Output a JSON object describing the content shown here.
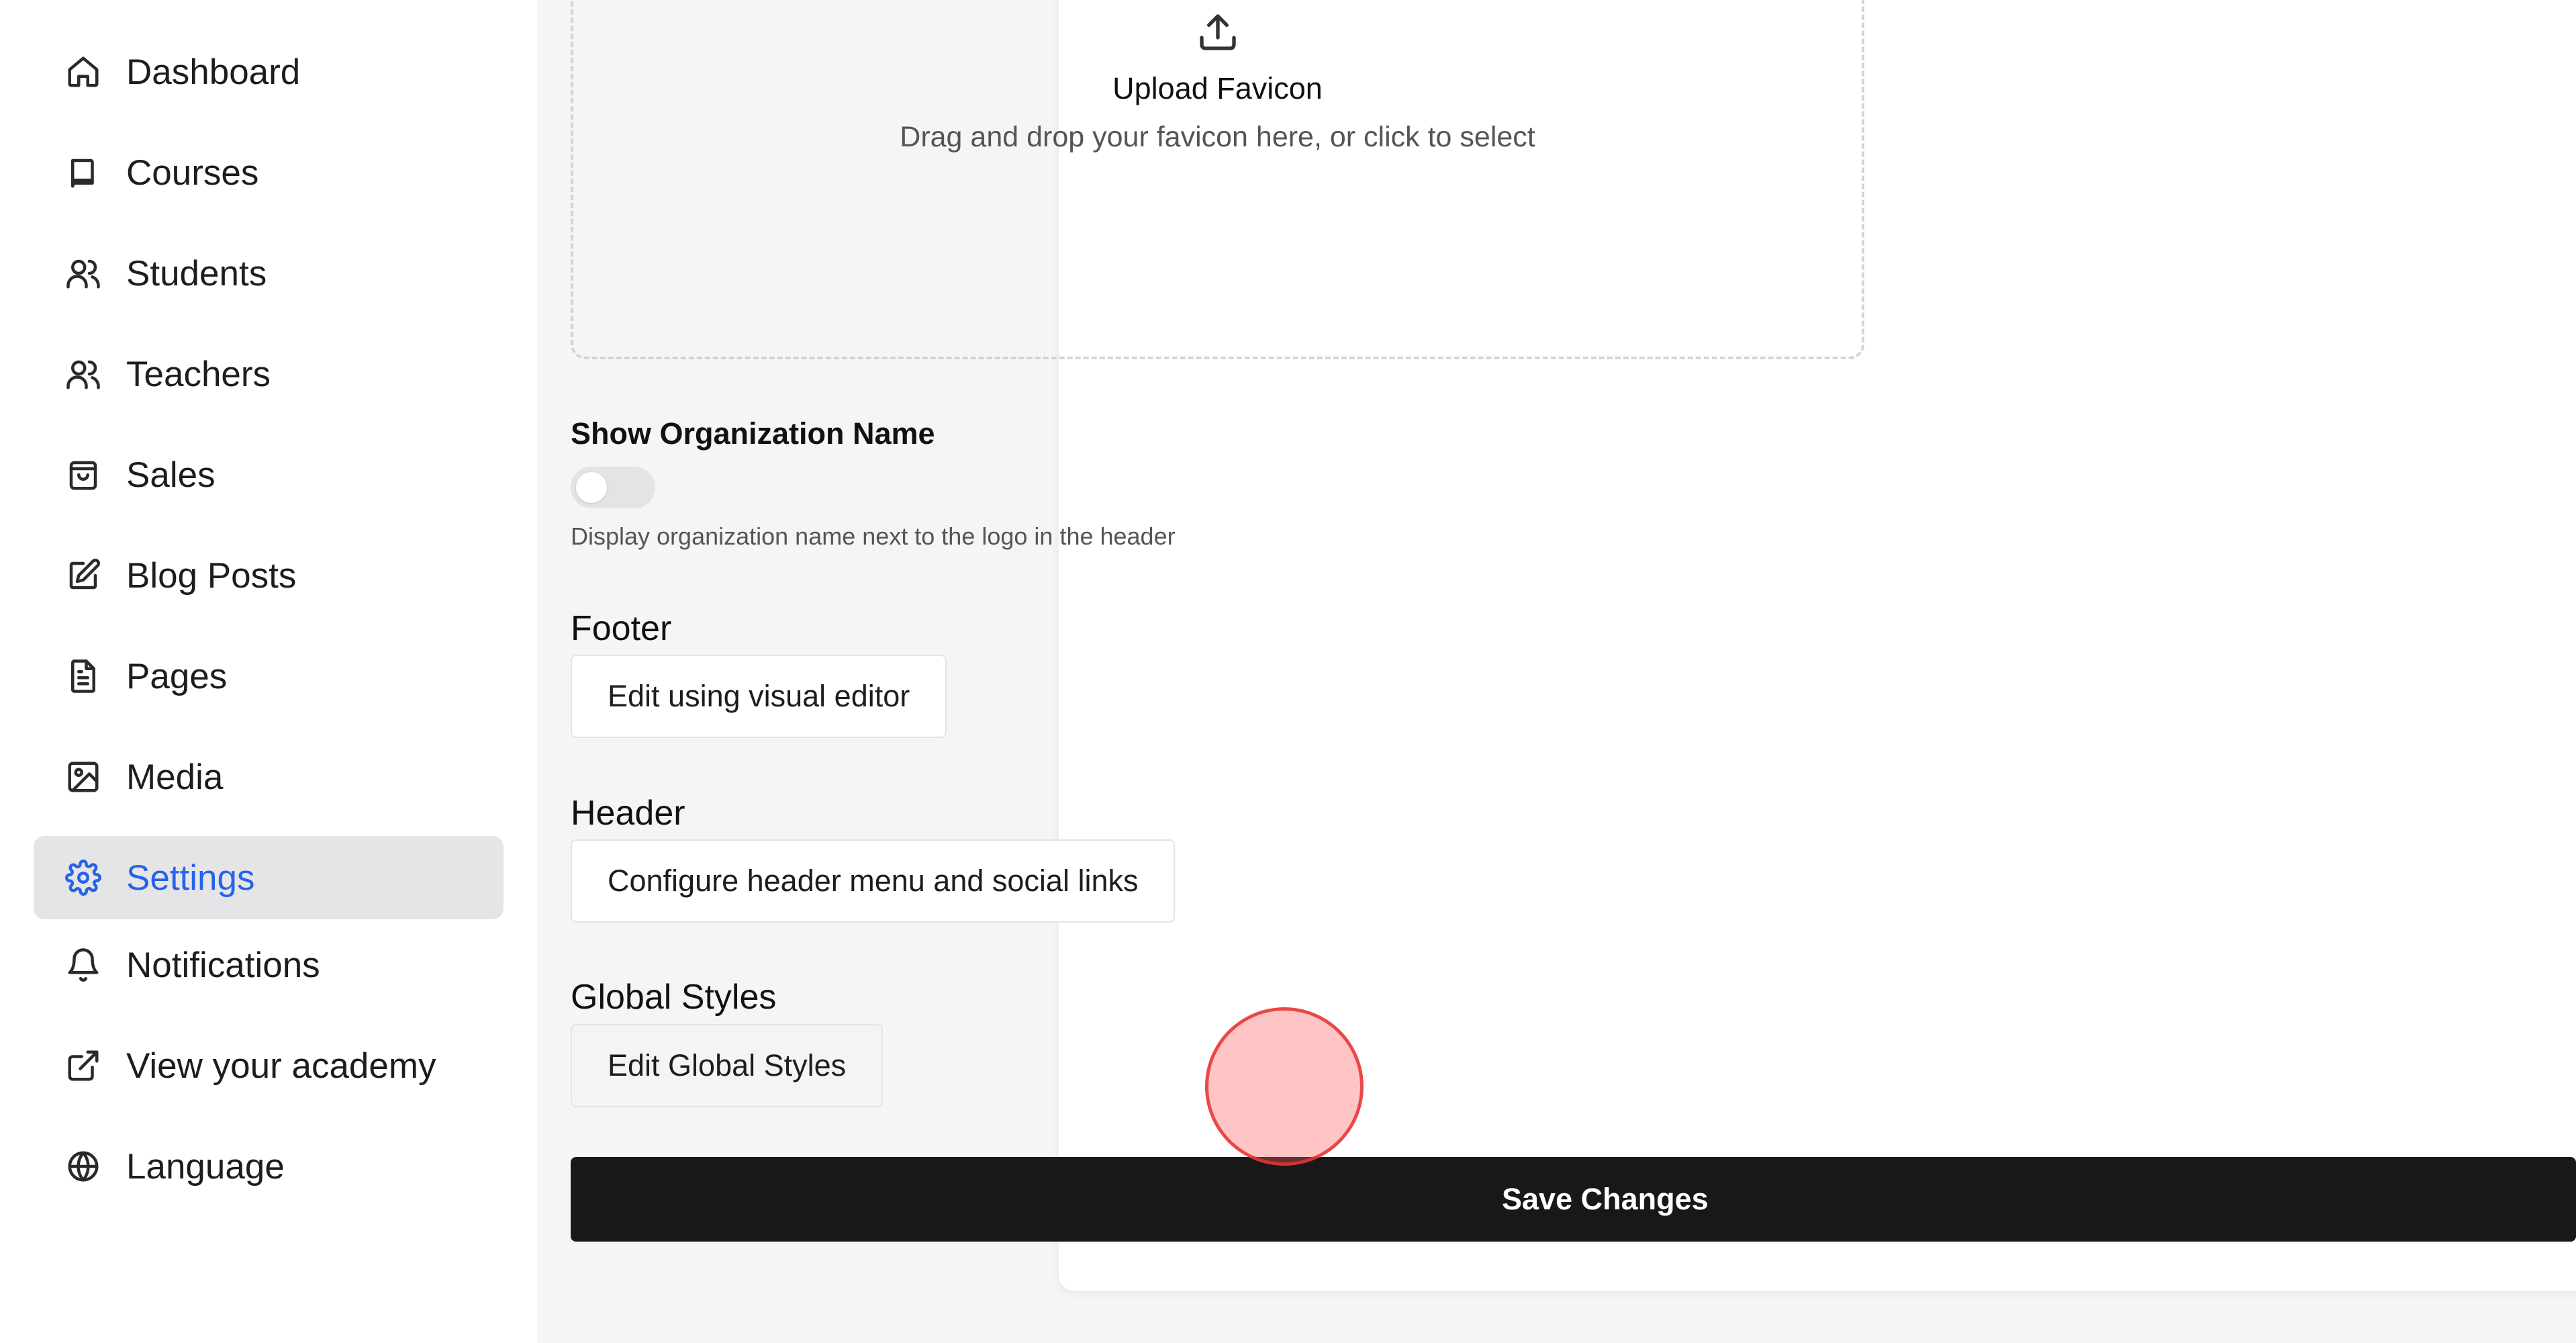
{
  "sidebar": {
    "items": [
      {
        "label": "Dashboard",
        "icon": "home-icon",
        "active": false
      },
      {
        "label": "Courses",
        "icon": "book-icon",
        "active": false
      },
      {
        "label": "Students",
        "icon": "users-icon",
        "active": false
      },
      {
        "label": "Teachers",
        "icon": "users-icon",
        "active": false
      },
      {
        "label": "Sales",
        "icon": "shopping-bag-icon",
        "active": false
      },
      {
        "label": "Blog Posts",
        "icon": "edit-icon",
        "active": false
      },
      {
        "label": "Pages",
        "icon": "file-text-icon",
        "active": false
      },
      {
        "label": "Media",
        "icon": "image-icon",
        "active": false
      },
      {
        "label": "Settings",
        "icon": "gear-icon",
        "active": true
      },
      {
        "label": "Notifications",
        "icon": "bell-icon",
        "active": false
      },
      {
        "label": "View your academy",
        "icon": "external-link-icon",
        "active": false
      },
      {
        "label": "Language",
        "icon": "globe-icon",
        "active": false
      }
    ],
    "active_color": "#2563eb"
  },
  "favicon_upload": {
    "title": "Upload Favicon",
    "hint": "Drag and drop your favicon here, or click to select",
    "icon": "upload-icon"
  },
  "org_name": {
    "label": "Show Organization Name",
    "enabled": false,
    "help": "Display organization name next to the logo in the header"
  },
  "footer": {
    "label": "Footer",
    "button": "Edit using visual editor"
  },
  "header": {
    "label": "Header",
    "button": "Configure header menu and social links"
  },
  "global_styles": {
    "label": "Global Styles",
    "button": "Edit Global Styles"
  },
  "save_button": "Save Changes"
}
